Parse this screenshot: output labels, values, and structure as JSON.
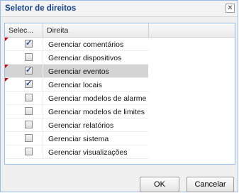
{
  "dialog": {
    "title": "Seletor de direitos",
    "close_glyph": "✕"
  },
  "grid": {
    "headers": [
      "Selec...",
      "Direita"
    ],
    "rows": [
      {
        "label": "Gerenciar comentários",
        "checked": true,
        "modified": true,
        "selected": false
      },
      {
        "label": "Gerenciar dispositivos",
        "checked": false,
        "modified": false,
        "selected": false
      },
      {
        "label": "Gerenciar eventos",
        "checked": true,
        "modified": true,
        "selected": true
      },
      {
        "label": "Gerenciar locais",
        "checked": true,
        "modified": true,
        "selected": false
      },
      {
        "label": "Gerenciar modelos de alarme",
        "checked": false,
        "modified": false,
        "selected": false
      },
      {
        "label": "Gerenciar modelos de limites",
        "checked": false,
        "modified": false,
        "selected": false
      },
      {
        "label": "Gerenciar relatórios",
        "checked": false,
        "modified": false,
        "selected": false
      },
      {
        "label": "Gerenciar sistema",
        "checked": false,
        "modified": false,
        "selected": false
      },
      {
        "label": "Gerenciar visualizações",
        "checked": false,
        "modified": false,
        "selected": false
      }
    ]
  },
  "buttons": {
    "ok": "OK",
    "cancel": "Cancelar"
  },
  "colors": {
    "title": "#15428b",
    "selected_row": "#d4d4d4",
    "dirty_marker": "#cc0000"
  }
}
